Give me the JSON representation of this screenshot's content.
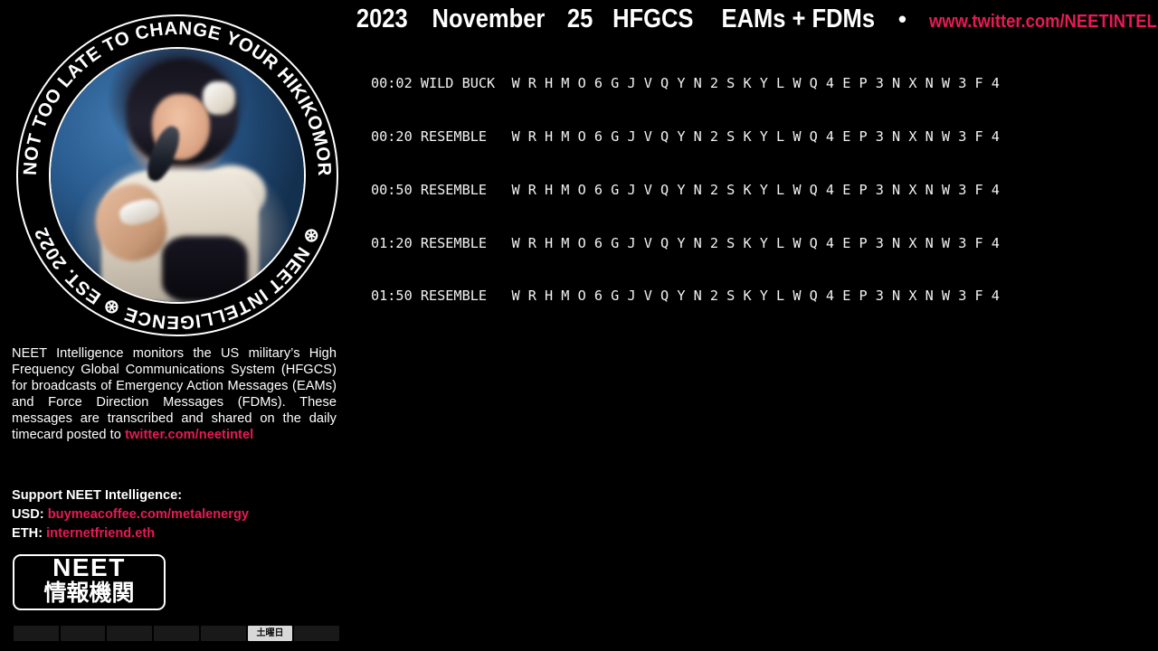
{
  "header": {
    "year": "2023",
    "month": "November",
    "day": "25",
    "system": "HFGCS",
    "subject": "EAMs + FDMs",
    "separator": "•",
    "url": "www.twitter.com/NEETINTEL",
    "url_color": "#e81a54"
  },
  "emblem": {
    "arc_top": "☹ IT’S NOT TOO LATE TO CHANGE YOUR HIKIKOMORI WAYS",
    "arc_bottom": "⊛ NEET INTELLIGENCE ⊛ EST. 2022",
    "photo_alt": "performer-singing-into-microphone"
  },
  "log": {
    "rows": [
      {
        "time": "00:02",
        "callsign": "WILD BUCK",
        "groups": "W R H M O 6 G J V Q Y N 2 S K Y L W Q 4 E P 3 N X N W 3 F 4"
      },
      {
        "time": "00:20",
        "callsign": "RESEMBLE",
        "groups": "W R H M O 6 G J V Q Y N 2 S K Y L W Q 4 E P 3 N X N W 3 F 4"
      },
      {
        "time": "00:50",
        "callsign": "RESEMBLE",
        "groups": "W R H M O 6 G J V Q Y N 2 S K Y L W Q 4 E P 3 N X N W 3 F 4"
      },
      {
        "time": "01:20",
        "callsign": "RESEMBLE",
        "groups": "W R H M O 6 G J V Q Y N 2 S K Y L W Q 4 E P 3 N X N W 3 F 4"
      },
      {
        "time": "01:50",
        "callsign": "RESEMBLE",
        "groups": "W R H M O 6 G J V Q Y N 2 S K Y L W Q 4 E P 3 N X N W 3 F 4"
      }
    ]
  },
  "description": {
    "body": "NEET Intelligence monitors the US military’s High Frequency Global Communications System (HFGCS) for broadcasts of Emergency Action Messages (EAMs) and Force Direction Messages (FDMs). These messages are transcribed and shared on the daily timecard posted to ",
    "link": "twitter.com/neetintel"
  },
  "support": {
    "heading": "Support NEET Intelligence:",
    "rows": [
      {
        "label": "USD:",
        "value": "buymeacoffee.com/metalenergy"
      },
      {
        "label": "ETH:",
        "value": "internetfriend.eth"
      }
    ]
  },
  "wordmark": {
    "latin": "NEET",
    "kanji": "情報機関"
  },
  "day_strip": {
    "cells": [
      {
        "label": "",
        "active": false
      },
      {
        "label": "",
        "active": false
      },
      {
        "label": "",
        "active": false
      },
      {
        "label": "",
        "active": false
      },
      {
        "label": "",
        "active": false
      },
      {
        "label": "土曜日",
        "active": true
      },
      {
        "label": "",
        "active": false
      }
    ]
  },
  "colors": {
    "background": "#000000",
    "text": "#ffffff",
    "accent": "#e81a54",
    "log_text": "#f2f2f2"
  }
}
